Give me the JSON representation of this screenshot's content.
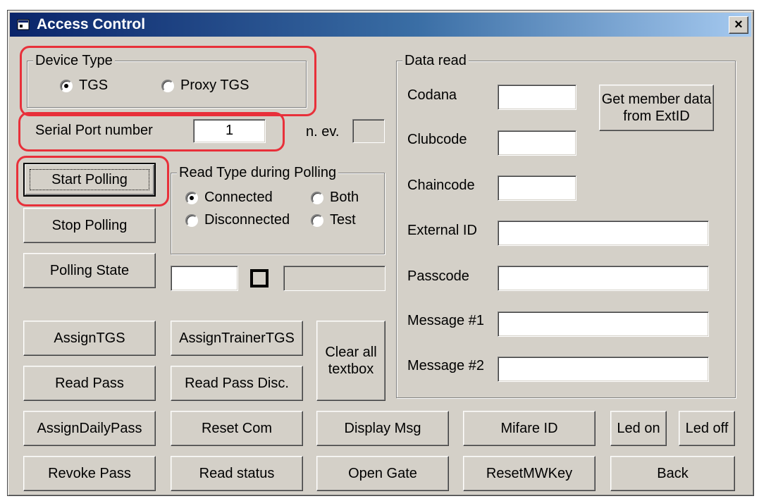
{
  "window": {
    "title": "Access Control",
    "close_glyph": "×",
    "icon": "app-window-icon"
  },
  "device_type": {
    "label": "Device Type",
    "options": [
      {
        "label": "TGS",
        "selected": true
      },
      {
        "label": "Proxy TGS",
        "selected": false
      }
    ]
  },
  "serial_port": {
    "label": "Serial Port number",
    "value": "1",
    "n_ev_label": "n. ev.",
    "n_ev_value": ""
  },
  "polling": {
    "start": "Start Polling",
    "stop": "Stop Polling",
    "state": "Polling State",
    "state_value": "",
    "state_value2": ""
  },
  "read_type": {
    "label": "Read Type during Polling",
    "options": [
      {
        "label": "Connected",
        "selected": true
      },
      {
        "label": "Both",
        "selected": false
      },
      {
        "label": "Disconnected",
        "selected": false
      },
      {
        "label": "Test",
        "selected": false
      }
    ]
  },
  "data_read": {
    "label": "Data read",
    "fields": [
      {
        "label": "Codana",
        "value": ""
      },
      {
        "label": "Clubcode",
        "value": ""
      },
      {
        "label": "Chaincode",
        "value": ""
      },
      {
        "label": "External ID",
        "value": ""
      },
      {
        "label": "Passcode",
        "value": ""
      },
      {
        "label": "Message #1",
        "value": ""
      },
      {
        "label": "Message #2",
        "value": ""
      }
    ],
    "get_member_button": "Get member data from ExtID"
  },
  "buttons": {
    "assign_tgs": "AssignTGS",
    "assign_trainer_tgs": "AssignTrainerTGS",
    "clear_all": "Clear all textbox",
    "read_pass": "Read Pass",
    "read_pass_disc": "Read Pass Disc.",
    "assign_daily_pass": "AssignDailyPass",
    "reset_com": "Reset Com",
    "display_msg": "Display Msg",
    "mifare_id": "Mifare ID",
    "led_on": "Led on",
    "led_off": "Led off",
    "revoke_pass": "Revoke Pass",
    "read_status": "Read status",
    "open_gate": "Open Gate",
    "reset_mw_key": "ResetMWKey",
    "back": "Back"
  },
  "colors": {
    "title_start": "#0a246a",
    "title_end": "#a6caf0",
    "face": "#d4d0c8",
    "highlight": "#e8303a"
  }
}
